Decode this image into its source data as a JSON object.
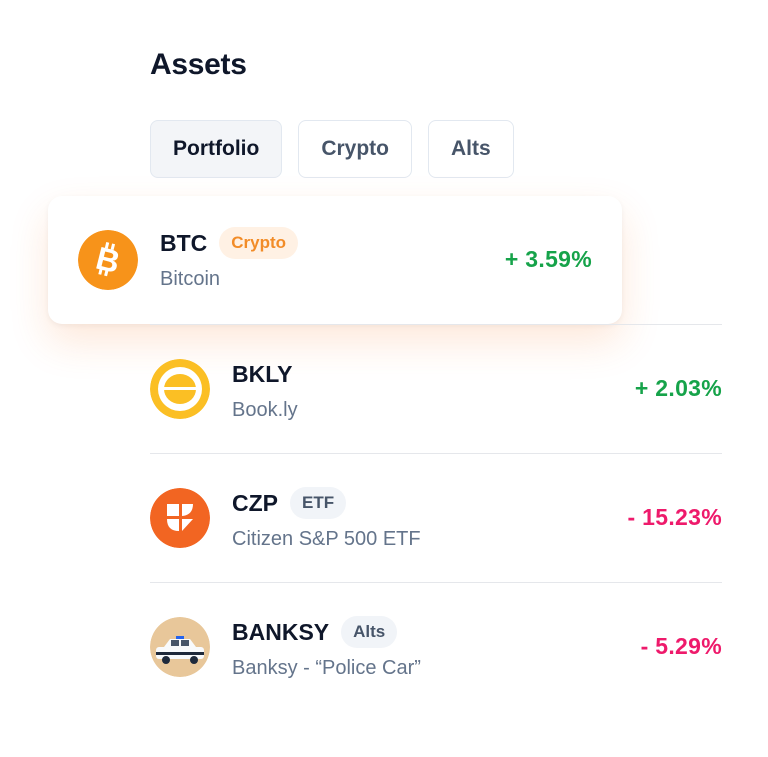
{
  "header": {
    "title": "Assets"
  },
  "tabs": [
    {
      "label": "Portfolio",
      "active": true
    },
    {
      "label": "Crypto",
      "active": false
    },
    {
      "label": "Alts",
      "active": false
    }
  ],
  "assets": [
    {
      "ticker": "BTC",
      "tag": "Crypto",
      "name": "Bitcoin",
      "change": "+ 3.59%",
      "icon": "bitcoin-icon"
    },
    {
      "ticker": "BKLY",
      "tag": "",
      "name": "Book.ly",
      "change": "+ 2.03%",
      "icon": "bookly-logo"
    },
    {
      "ticker": "CZP",
      "tag": "ETF",
      "name": "Citizen S&P 500 ETF",
      "change": "- 15.23%",
      "icon": "citizen-logo"
    },
    {
      "ticker": "BANKSY",
      "tag": "Alts",
      "name": "Banksy - “Police Car”",
      "change": "- 5.29%",
      "icon": "police-car-artwork"
    }
  ],
  "colors": {
    "positive": "#16a34a",
    "negative": "#ee1a6b",
    "crypto_accent": "#f7931a"
  }
}
